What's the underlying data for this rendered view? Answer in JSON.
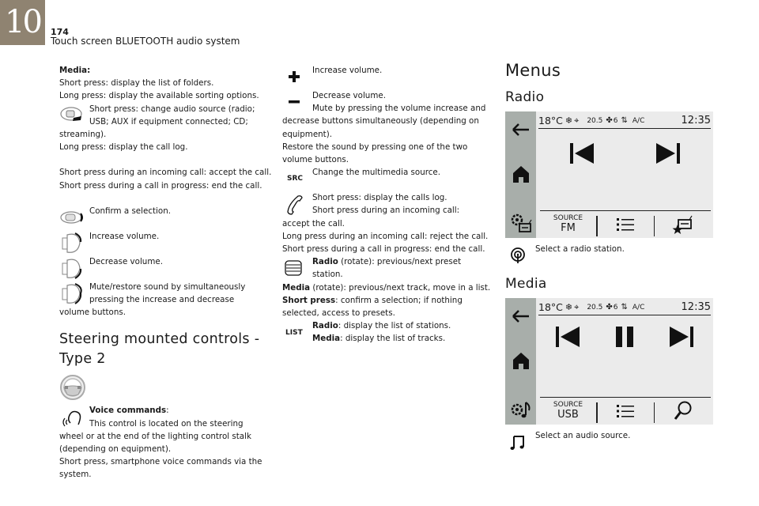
{
  "header": {
    "chapter": "10",
    "page_number": "174",
    "title": "Touch screen BLUETOOTH audio system"
  },
  "col1": {
    "media_label": "Media:",
    "media_short": "Short press: display the list of folders.",
    "media_long": "Long press: display the available sorting options.",
    "source_short_a": "Short press: change audio source (radio;",
    "source_short_b": "USB; AUX if equipment connected; CD;",
    "source_short_c": "streaming).",
    "source_long": "Long press: display the call log.",
    "call_accept": "Short press during an incoming call: accept the call.",
    "call_end": "Short press during a call in progress: end the call.",
    "confirm": "Confirm a selection.",
    "vol_up": "Increase volume.",
    "vol_down": "Decrease volume.",
    "mute_a": "Mute/restore sound by simultaneously",
    "mute_b": "pressing the increase and decrease",
    "mute_c": "volume buttons.",
    "section_title": "Steering mounted controls - Type 2",
    "voice_label": "Voice commands",
    "voice_colon": ":",
    "voice_a": "This control is located on the steering",
    "voice_b": "wheel or at the end of the lighting control stalk (depending on equipment).",
    "voice_c": "Short press, smartphone voice commands via the system."
  },
  "col2": {
    "plus": "Increase volume.",
    "minus_a": "Decrease volume.",
    "minus_b": "Mute by pressing the volume increase and",
    "minus_c": "decrease buttons simultaneously (depending on equipment).",
    "restore": "Restore the sound by pressing one of the two volume buttons.",
    "src_icon": "SRC",
    "src_desc": "Change the multimedia source.",
    "phone_a": "Short press: display the calls log.",
    "phone_b": "Short press during an incoming call:",
    "phone_c": "accept the call.",
    "phone_d": "Long press during an incoming call: reject the call.",
    "phone_e": "Short press during a call in progress: end the call.",
    "wheel_radio": "Radio",
    "wheel_radio_desc": " (rotate): previous/next preset station.",
    "wheel_media": "Media",
    "wheel_media_desc": " (rotate): previous/next track, move in a list.",
    "wheel_short": "Short press",
    "wheel_short_desc": ": confirm a selection; if nothing selected, access to presets.",
    "list_icon": "LIST",
    "list_radio": "Radio",
    "list_radio_desc": ": display the list of stations.",
    "list_media": "Media",
    "list_media_desc": ": display the list of tracks."
  },
  "col3": {
    "menus_title": "Menus",
    "radio_title": "Radio",
    "media_title": "Media",
    "status": {
      "temp": "18°C",
      "fan_temp": "20.5",
      "fan_speed": "6",
      "ac": "A/C",
      "clock": "12:35"
    },
    "radio_screen": {
      "source_label": "SOURCE",
      "source_value": "FM"
    },
    "media_screen": {
      "source_label": "SOURCE",
      "source_value": "USB"
    },
    "radio_desc": "Select a radio station.",
    "media_desc": "Select an audio source."
  },
  "colors": {
    "chapter_bg": "#8f8371",
    "screen_bg": "#ebebeb",
    "screen_sidebar": "#a8aeaa"
  }
}
